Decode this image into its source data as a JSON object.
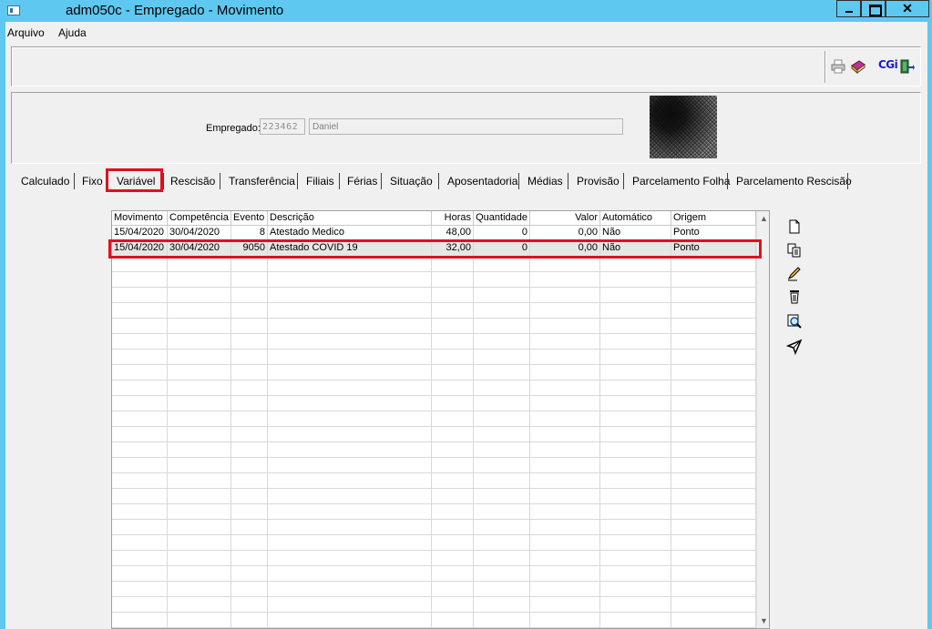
{
  "window": {
    "title": "adm050c - Empregado - Movimento",
    "close_glyph": "✕"
  },
  "menu": {
    "items": [
      "Arquivo",
      "Ajuda"
    ]
  },
  "toolbar": {
    "icons": [
      "printer-icon",
      "book-icon",
      "cgi-logo",
      "exit-door-icon"
    ],
    "cgi_label": "CGi"
  },
  "employee": {
    "label": "Empregado:",
    "code": "223462",
    "name": "Daniel"
  },
  "tabs": {
    "items": [
      "Calculado",
      "Fixo",
      "Variável",
      "Rescisão",
      "Transferência",
      "Filiais",
      "Férias",
      "Situação",
      "Aposentadoria",
      "Médias",
      "Provisão",
      "Parcelamento Folha",
      "Parcelamento Rescisão"
    ],
    "active": "Variável"
  },
  "grid": {
    "columns": [
      "Movimento",
      "Competência",
      "Evento",
      "Descrição",
      "Horas",
      "Quantidade",
      "Valor",
      "Automático",
      "Origem"
    ],
    "rows": [
      {
        "movimento": "15/04/2020",
        "competencia": "30/04/2020",
        "evento": "8",
        "descricao": "Atestado Medico",
        "horas": "48,00",
        "quantidade": "0",
        "valor": "0,00",
        "automatico": "Não",
        "origem": "Ponto"
      },
      {
        "movimento": "15/04/2020",
        "competencia": "30/04/2020",
        "evento": "9050",
        "descricao": "Atestado COVID 19",
        "horas": "32,00",
        "quantidade": "0",
        "valor": "0,00",
        "automatico": "Não",
        "origem": "Ponto"
      }
    ],
    "selected_row": 1
  },
  "side_actions": [
    "new-document-icon",
    "copy-icon",
    "edit-pencil-icon",
    "delete-trash-icon",
    "search-zoom-icon",
    "send-arrow-icon"
  ],
  "colors": {
    "titlebar": "#5ec8f0",
    "highlight": "#e01020"
  }
}
